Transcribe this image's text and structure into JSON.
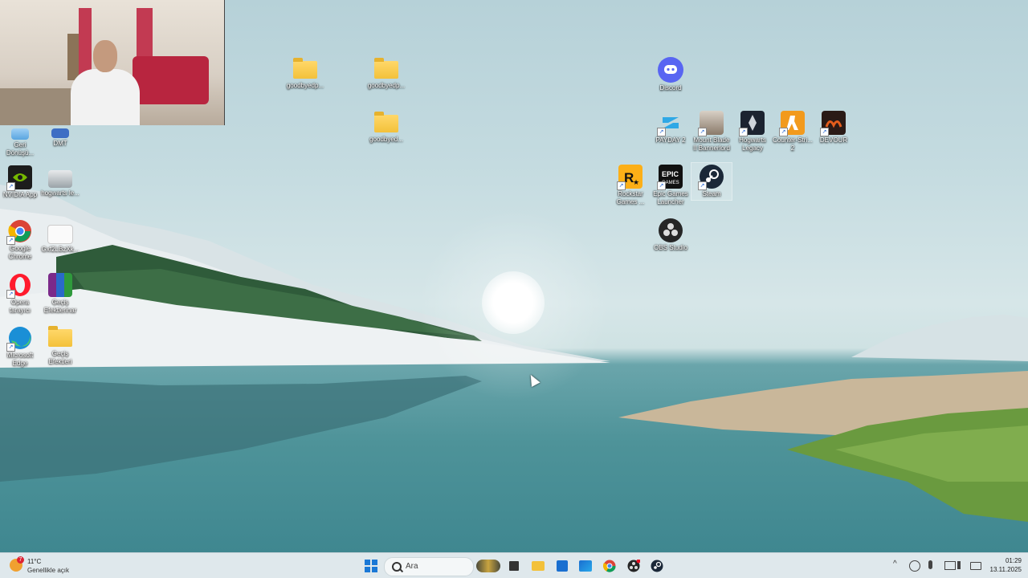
{
  "desktop": {
    "icons_left": [
      {
        "label": "Geri Dönüşü...",
        "icon": "recycle-bin-icon"
      },
      {
        "label": "DMT",
        "icon": "computer-icon"
      },
      {
        "label": "NVIDIA App",
        "icon": "nvidia-icon"
      },
      {
        "label": "hogwarts le...",
        "icon": "image-file-icon"
      },
      {
        "label": "Google Chrome",
        "icon": "chrome-icon"
      },
      {
        "label": "Gxf2LBzXk...",
        "icon": "document-icon"
      },
      {
        "label": "Opera tarayıcı",
        "icon": "opera-icon"
      },
      {
        "label": "Geçiş Efektlerinar",
        "icon": "winrar-icon"
      },
      {
        "label": "Microsoft Edge",
        "icon": "edge-icon"
      },
      {
        "label": "Geçiş Efektleri",
        "icon": "folder-icon"
      }
    ],
    "folders_top": [
      {
        "label": "goodbyedp..."
      },
      {
        "label": "goodbyedp..."
      },
      {
        "label": "goodbyed..."
      }
    ],
    "icons_right": [
      {
        "label": "Discord",
        "icon": "discord-icon"
      },
      {
        "label": "PAYDAY 2",
        "icon": "payday-icon"
      },
      {
        "label": "Mount Blade II Bannerlord",
        "icon": "bannerlord-icon"
      },
      {
        "label": "Hogwarts Legacy",
        "icon": "hogwarts-icon"
      },
      {
        "label": "Counter-Stri... 2",
        "icon": "counter-strike-icon"
      },
      {
        "label": "DEVOUR",
        "icon": "devour-icon"
      },
      {
        "label": "Rockstar Games ...",
        "icon": "rockstar-icon"
      },
      {
        "label": "Epic Games Launcher",
        "icon": "epic-games-icon"
      },
      {
        "label": "Steam",
        "icon": "steam-icon"
      },
      {
        "label": "OBS Studio",
        "icon": "obs-icon"
      }
    ]
  },
  "taskbar": {
    "weather": {
      "temp": "11°C",
      "desc": "Genellikle açık",
      "badge": "7"
    },
    "search_placeholder": "Ara",
    "apps": [
      "start-icon",
      "search-icon",
      "widget-icon",
      "taskview-icon",
      "file-explorer-icon",
      "store-icon",
      "outlook-icon",
      "chrome-icon",
      "obs-icon",
      "steam-icon"
    ],
    "tray": {
      "chevron": "^",
      "time": "01:29",
      "date": "13.11.2025"
    }
  },
  "colors": {
    "taskbar_bg": "#dfe8ec",
    "label_text": "#ffffff",
    "folder": "#f3c13a"
  }
}
